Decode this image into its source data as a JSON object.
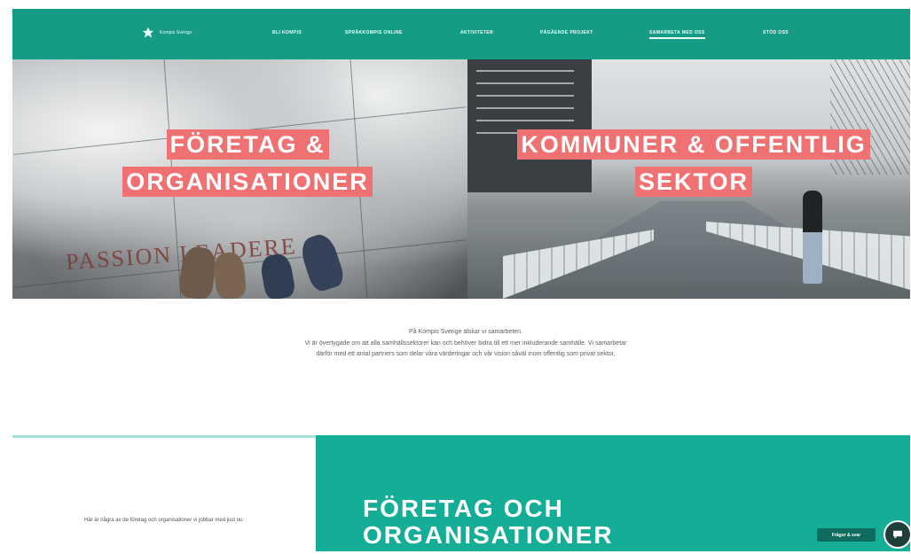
{
  "colors": {
    "brand": "#169b85",
    "accent": "#f07172",
    "section_bg": "#14ae97"
  },
  "nav": {
    "logo_text": "Kompis Sverige",
    "items": [
      {
        "label": "BLI KOMPIS"
      },
      {
        "label": "SPRÅKKOMPIS ONLINE"
      },
      {
        "label": "AKTIVITETER"
      },
      {
        "label": "PÅGÅENDE PROJEKT"
      },
      {
        "label": "SAMARBETA MED OSS",
        "active": true
      },
      {
        "label": "STÖD OSS"
      }
    ]
  },
  "hero": {
    "left": {
      "title": "FÖRETAG & ORGANISATIONER",
      "background_word": "PASSION LEADERE"
    },
    "right": {
      "title": "KOMMUNER & OFFENTLIG SEKTOR"
    }
  },
  "intro": {
    "line1": "På Kompis Sverige älskar vi samarbeten.",
    "line2": "Vi är övertygade om att alla samhällssektorer kan och behöver bidra till ett mer inkluderande samhälle. Vi samarbetar därför med ett antal partners som delar våra värderingar och vår vision såväl inom offentlig som privat sektor."
  },
  "bottom": {
    "left_text": "Här är några av de företag och organisationer vi jobbar med just nu:",
    "section_heading": "FÖRETAG OCH ORGANISATIONER"
  },
  "floating": {
    "faq_label": "Frågor & svar",
    "chat_icon": "chat-icon"
  }
}
